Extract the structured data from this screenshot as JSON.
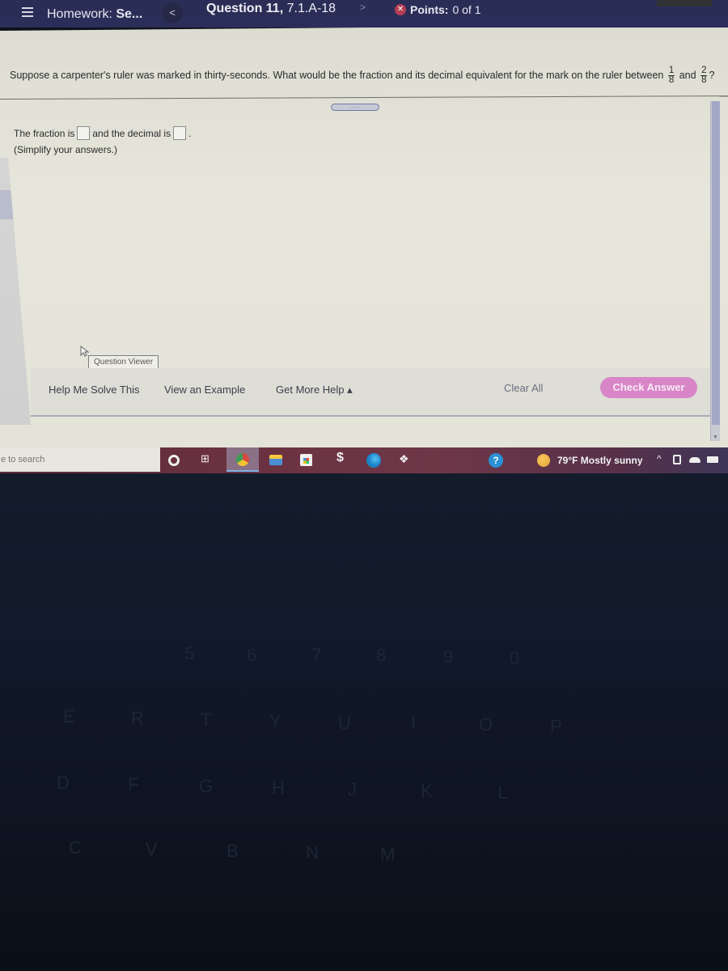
{
  "topbar": {
    "homework_label": "Homework:",
    "homework_name": "Se...",
    "prev_label": "<",
    "question_label": "Question 11,",
    "question_id": "7.1.A-18",
    "next_label": ">",
    "points_label": "Points:",
    "points_value": "0 of 1",
    "status_icon": "x-circle-icon",
    "status_color": "#b33d53"
  },
  "question": {
    "text": "Suppose a carpenter's ruler was marked in thirty-seconds. What would be the fraction and its decimal equivalent for the mark on the ruler between",
    "frac1_num": "1",
    "frac1_den": "8",
    "joiner": "and",
    "frac2_num": "2",
    "frac2_den": "8",
    "end": "?",
    "expand_label": "....."
  },
  "answer": {
    "prefix": "The fraction is",
    "middle": "and the decimal is",
    "suffix": ".",
    "fraction_value": "",
    "decimal_value": "",
    "instruction": "(Simplify your answers.)"
  },
  "tooltip": {
    "label": "Question Viewer"
  },
  "actions": {
    "help_me_solve": "Help Me Solve This",
    "view_example": "View an Example",
    "get_more_help": "Get More Help ▴",
    "clear_all": "Clear All",
    "check_answer": "Check Answer",
    "check_answer_color": "#d886c8"
  },
  "taskbar": {
    "search_placeholder": "e to search",
    "weather": "79°F  Mostly sunny",
    "icons": [
      "cortana-icon",
      "task-view-icon",
      "chrome-icon",
      "file-explorer-icon",
      "store-icon",
      "zap-icon",
      "edge-icon",
      "dropbox-icon",
      "help-icon",
      "weather-icon",
      "tray-chevron-icon",
      "meet-icon",
      "onedrive-icon",
      "battery-icon"
    ]
  },
  "keyboard": {
    "keys": [
      "5",
      "6",
      "7",
      "8",
      "9",
      "0",
      "E",
      "R",
      "T",
      "Y",
      "U",
      "I",
      "O",
      "P",
      "D",
      "F",
      "G",
      "H",
      "J",
      "K",
      "L",
      "C",
      "V",
      "B",
      "N",
      "M"
    ]
  }
}
